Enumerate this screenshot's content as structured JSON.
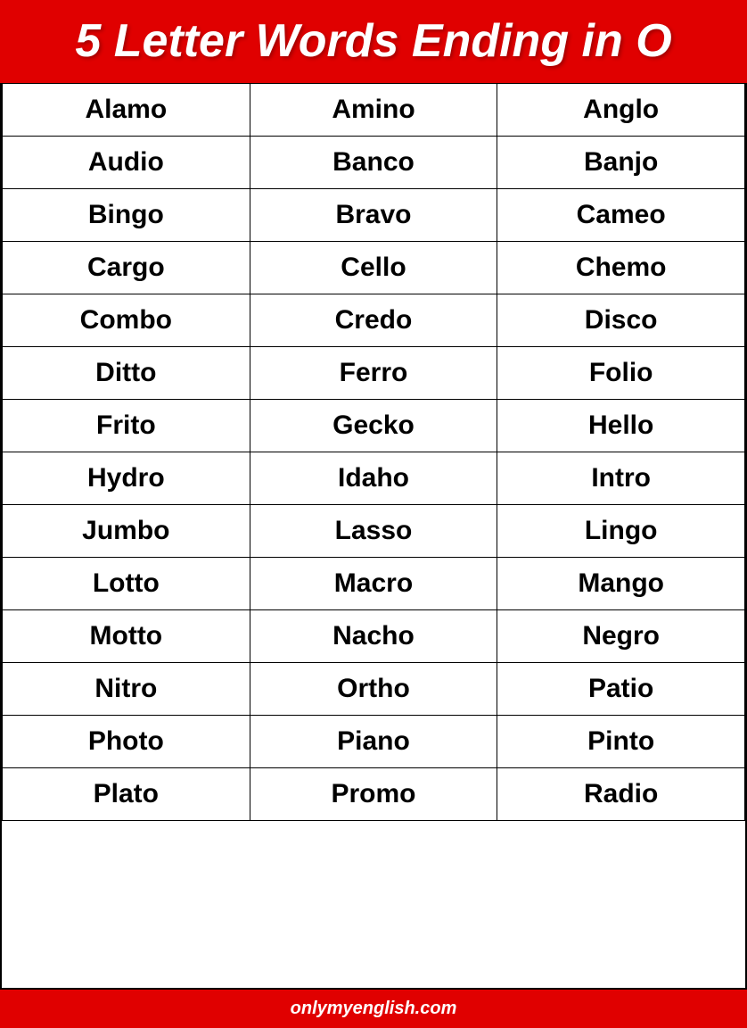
{
  "header": {
    "title": "5 Letter Words Ending in O"
  },
  "table": {
    "rows": [
      [
        "Alamo",
        "Amino",
        "Anglo"
      ],
      [
        "Audio",
        "Banco",
        "Banjo"
      ],
      [
        "Bingo",
        "Bravo",
        "Cameo"
      ],
      [
        "Cargo",
        "Cello",
        "Chemo"
      ],
      [
        "Combo",
        "Credo",
        "Disco"
      ],
      [
        "Ditto",
        "Ferro",
        "Folio"
      ],
      [
        "Frito",
        "Gecko",
        "Hello"
      ],
      [
        "Hydro",
        "Idaho",
        "Intro"
      ],
      [
        "Jumbo",
        "Lasso",
        "Lingo"
      ],
      [
        "Lotto",
        "Macro",
        "Mango"
      ],
      [
        "Motto",
        "Nacho",
        "Negro"
      ],
      [
        "Nitro",
        "Ortho",
        "Patio"
      ],
      [
        "Photo",
        "Piano",
        "Pinto"
      ],
      [
        "Plato",
        "Promo",
        "Radio"
      ]
    ]
  },
  "footer": {
    "text": "onlymyenglish.com"
  }
}
